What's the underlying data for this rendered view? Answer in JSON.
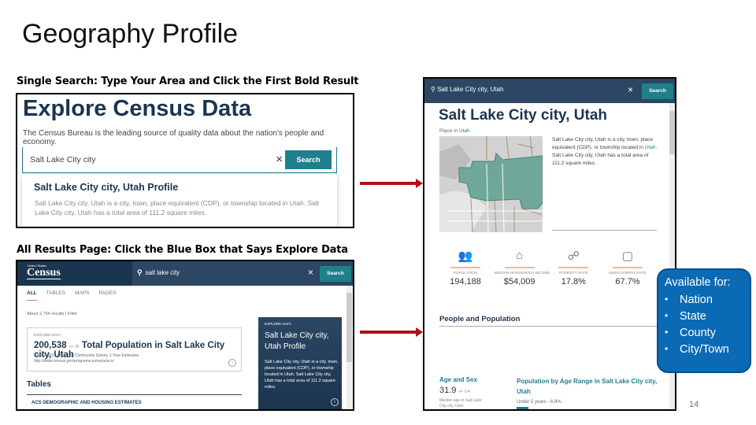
{
  "slide": {
    "title": "Geography Profile",
    "caption_single_search": "Single Search: Type Your Area and Click the First Bold Result",
    "caption_all_results": "All Results Page: Click the Blue Box that Says Explore Data",
    "page_number": "14"
  },
  "explore_panel": {
    "heading": "Explore Census Data",
    "subheading": "The Census Bureau is the leading source of quality data about the nation's people and economy.",
    "search_value": "Salt Lake City city",
    "clear_icon": "×",
    "search_button": "Search",
    "suggestion_title": "Salt Lake City city, Utah Profile",
    "suggestion_desc": "Salt Lake City city, Utah is a city, town, place equivalent (CDP), or township located in Utah. Salt Lake City city, Utah has a total area of 111.2 square miles."
  },
  "results_panel": {
    "logo_small": "United States",
    "logo": "Census",
    "search_icon": "⚲",
    "search_value": "salt lake city",
    "clear_icon": "×",
    "search_button": "Search",
    "tabs": [
      {
        "label": "ALL",
        "active": true
      },
      {
        "label": "TABLES",
        "active": false
      },
      {
        "label": "MAPS",
        "active": false
      },
      {
        "label": "PAGES",
        "active": false
      }
    ],
    "result_count": "About 2,794 results | Filter",
    "card": {
      "kicker": "EXPLORE DATA",
      "value": "200,538",
      "moe": "+/- 35",
      "title": "Total Population in Salt Lake City city, Utah",
      "source": "Source 2017 American Community Survey 1-Year Estimates",
      "url": "http://www.census.gov/programs-surveys/acs/"
    },
    "tables_heading": "Tables",
    "tables_first": "ACS DEMOGRAPHIC AND HOUSING ESTIMATES",
    "explore_box": {
      "kicker": "EXPLORE DATA",
      "title": "Salt Lake City city, Utah Profile",
      "desc": "Salt Lake City city, Utah is a city, town, place equivalent (CDP), or township located in Utah. Salt Lake City city, Utah has a total area of 111.2 square miles."
    }
  },
  "profile_panel": {
    "search_value": "Salt Lake City city, Utah",
    "clear_icon": "×",
    "search_button": "Search",
    "heading": "Salt Lake City city, Utah",
    "place_prefix": "Place in ",
    "place_link": "Utah",
    "desc_before": "Salt Lake City city, Utah is a city, town, place equivalent (CDP), or township located in ",
    "desc_link": "Utah",
    "desc_after": ". Salt Lake City city, Utah has a total area of 111.2 square miles.",
    "stats": [
      {
        "icon": "people-icon",
        "glyph": "👥",
        "label": "POPULATION",
        "value": "194,188"
      },
      {
        "icon": "house-icon",
        "glyph": "⌂",
        "label": "MEDIAN HOUSEHOLD INCOME",
        "value": "$54,009"
      },
      {
        "icon": "hand-coin-icon",
        "glyph": "☍",
        "label": "POVERTY RATE",
        "value": "17.8%"
      },
      {
        "icon": "briefcase-icon",
        "glyph": "▢",
        "label": "EMPLOYMENT RATE",
        "value": "67.7%"
      }
    ],
    "section_title": "People and Population",
    "age_sex_title": "Age and Sex",
    "median_age": "31.9",
    "median_moe": "+/- 0.4",
    "median_label": "Median age in Salt Lake City city, Utah",
    "age_range_title": "Population by Age Range in Salt Lake City city, Utah",
    "under5": "Under 5 years - 6.8%"
  },
  "callout": {
    "title": "Available for:",
    "items": [
      "Nation",
      "State",
      "County",
      "City/Town"
    ]
  },
  "colors": {
    "navy": "#1b3550",
    "teal": "#1f7f8c",
    "arrow_red": "#b01116",
    "callout_blue": "#0a6ab3",
    "map_green": "#6fa89a"
  }
}
